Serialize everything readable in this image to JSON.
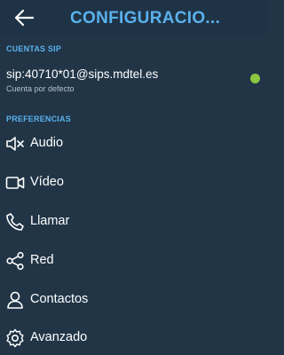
{
  "header": {
    "back_icon": "arrow-left-icon",
    "title": "CONFIGURACIO..."
  },
  "sip_section": {
    "heading": "CUENTAS SIP",
    "account": {
      "address": "sip:40710*01@sips.mdtel.es",
      "subtitle": "Cuenta por defecto",
      "status_color": "#8dc63f"
    }
  },
  "preferences_section": {
    "heading": "PREFERENCIAS",
    "items": [
      {
        "label": "Audio",
        "icon": "speaker-icon"
      },
      {
        "label": "Vídeo",
        "icon": "video-camera-icon"
      },
      {
        "label": "Llamar",
        "icon": "phone-icon"
      },
      {
        "label": "Red",
        "icon": "share-network-icon"
      },
      {
        "label": "Contactos",
        "icon": "person-icon"
      },
      {
        "label": "Avanzado",
        "icon": "gear-icon"
      }
    ]
  },
  "colors": {
    "background": "#213547",
    "accent": "#5ab1ec",
    "status_online": "#8dc63f"
  }
}
